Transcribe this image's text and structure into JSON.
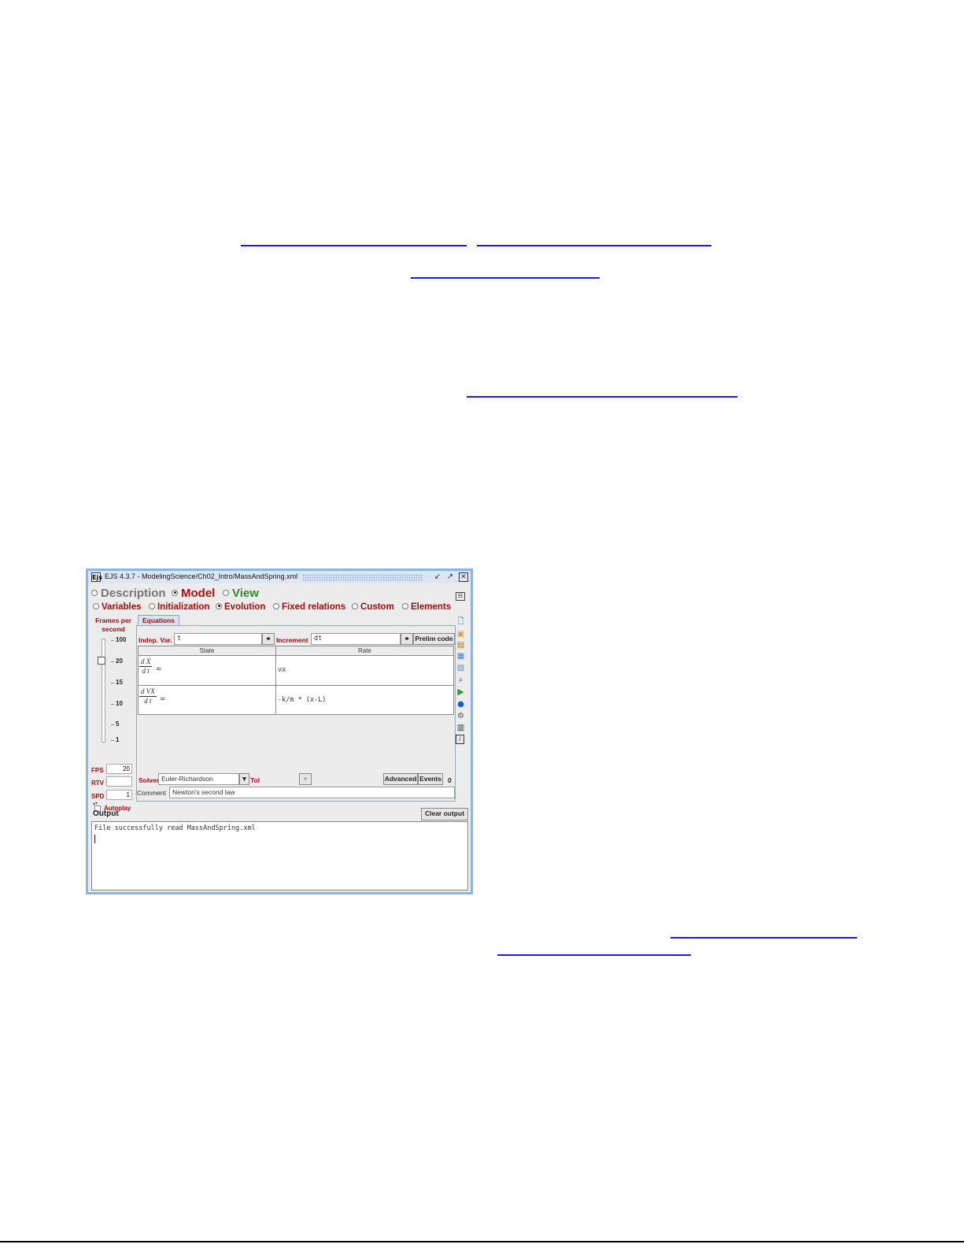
{
  "window": {
    "icon_text": "Ejs",
    "title": "EJS 4.3.7 - ModelingScience/Ch02_Intro/MassAndSpring.xml"
  },
  "main_tabs": [
    {
      "label": "Description",
      "selected": false,
      "color": "#777777"
    },
    {
      "label": "Model",
      "selected": true,
      "color": "#b01010"
    },
    {
      "label": "View",
      "selected": false,
      "color": "#2f8a2f"
    }
  ],
  "model_tabs": [
    {
      "label": "Variables",
      "selected": false
    },
    {
      "label": "Initialization",
      "selected": false
    },
    {
      "label": "Evolution",
      "selected": true
    },
    {
      "label": "Fixed relations",
      "selected": false
    },
    {
      "label": "Custom",
      "selected": false
    },
    {
      "label": "Elements",
      "selected": false
    }
  ],
  "left_panel": {
    "title": "Frames per second",
    "ticks": [
      "100",
      "20",
      "15",
      "10",
      "5",
      "1"
    ],
    "fps_label": "FPS",
    "fps_value": "20",
    "rtv_label": "RTV",
    "rtv_value": "",
    "spd_label": "SPD",
    "spd_value": "1",
    "autoplay_label": "Autoplay"
  },
  "equations": {
    "tab_label": "Equations",
    "indep_var_label": "Indep. Var.",
    "indep_var_value": "t",
    "increment_label": "Increment",
    "increment_value": "dt",
    "prelim_button": "Prelim code",
    "col_state": "State",
    "col_rate": "Rate",
    "rows": [
      {
        "num": "d X",
        "den": "d t",
        "eq": "=",
        "rate": "vx"
      },
      {
        "num": "d VX",
        "den": "d t",
        "eq": "=",
        "rate": "-k/m * (x-L)"
      }
    ],
    "solver_label": "Solver",
    "solver_value": "Euler-Richardson",
    "tol_label": "Tol",
    "advanced_button": "Advanced",
    "events_button": "Events",
    "events_count": "0",
    "comment_label": "Comment",
    "comment_value": "Newton's second law"
  },
  "output": {
    "label": "Output",
    "clear_button": "Clear output",
    "text": "File successfully read MassAndSpring.xml"
  },
  "colors": {
    "link": "#1a1aee",
    "label_red": "#a01010",
    "window_frame": "#8fb3e3"
  }
}
